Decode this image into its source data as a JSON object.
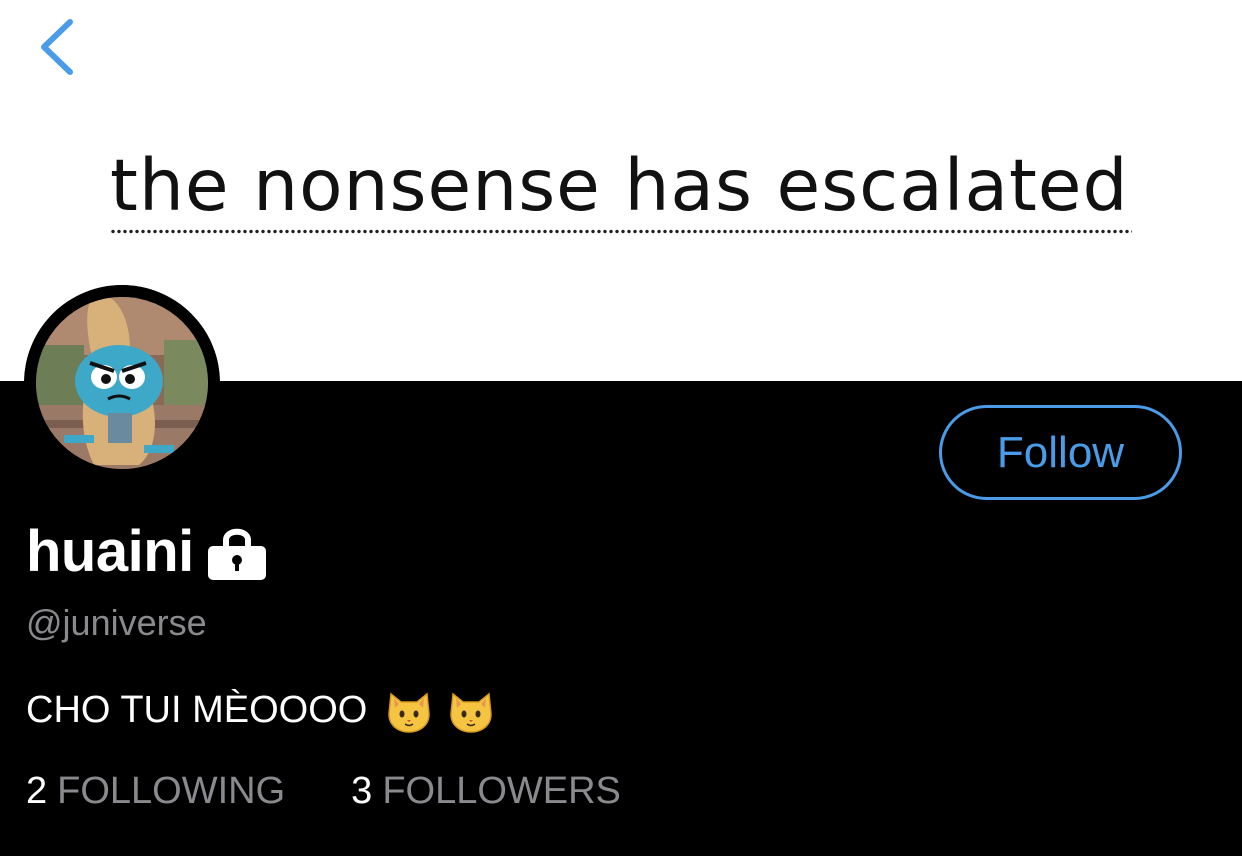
{
  "header": {
    "back_icon": "chevron-left-icon",
    "banner_text": "the nonsense has escalated"
  },
  "profile": {
    "avatar_description_icon": "avatar-cartoon-image",
    "follow_label": "Follow",
    "display_name": "huaini",
    "protected_icon": "lock-icon",
    "handle": "@juniverse",
    "bio": {
      "text": "CHO TUI MÈOOOO",
      "emoji_icons": [
        "cat-face-emoji",
        "cat-face-emoji"
      ]
    },
    "stats": {
      "following_count": "2",
      "following_label": "FOLLOWING",
      "followers_count": "3",
      "followers_label": "FOLLOWERS"
    }
  },
  "colors": {
    "accent": "#4a9be8",
    "background": "#000000",
    "banner_background": "#ffffff",
    "secondary_text": "#8a8a8e",
    "primary_text": "#ffffff"
  }
}
